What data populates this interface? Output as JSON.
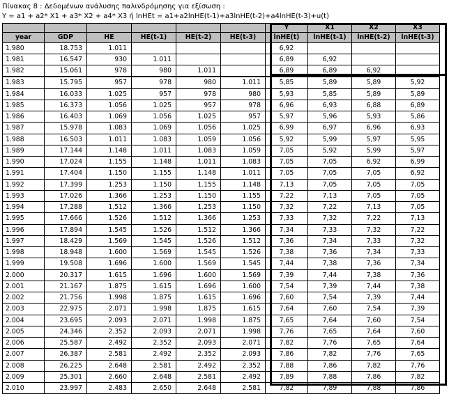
{
  "caption": {
    "line1": "Πίνακας 8 : Δεδομένων ανάλυσης παλινδρόμησης για εξίσωση :",
    "line2": "Y = a1 + a2* X1 + a3* X2 + a4* X3  ή    lnHEt = a1+a2lnHE(t-1)+a3lnHE(t-2)+a4lnHE(t-3)+u(t)"
  },
  "table": {
    "top_headers": [
      "",
      "",
      "",
      "",
      "",
      "",
      "Y",
      "X1",
      "X2",
      "X3"
    ],
    "headers": [
      "year",
      "GDP",
      "HE",
      "HE(t-1)",
      "HE(t-2)",
      "HE(t-3)",
      "lnHE(t)",
      "lnHE(t-1)",
      "lnHE(t-2)",
      "lnHE(t-3)"
    ],
    "rows": [
      [
        "1.980",
        "18.753",
        "1.011",
        "",
        "",
        "",
        "6,92",
        "",
        "",
        ""
      ],
      [
        "1.981",
        "16.547",
        "930",
        "1.011",
        "",
        "",
        "6,89",
        "6,92",
        "",
        ""
      ],
      [
        "1.982",
        "15.061",
        "978",
        "980",
        "1.011",
        "",
        "6,89",
        "6,89",
        "6,92",
        ""
      ],
      [
        "1.983",
        "15.795",
        "957",
        "978",
        "980",
        "1.011",
        "5,85",
        "5,89",
        "5,89",
        "5,92"
      ],
      [
        "1.984",
        "16.033",
        "1.025",
        "957",
        "978",
        "980",
        "5,93",
        "5,85",
        "5,89",
        "5,89"
      ],
      [
        "1.985",
        "16.373",
        "1.056",
        "1.025",
        "957",
        "978",
        "6,96",
        "6,93",
        "6,88",
        "6,89"
      ],
      [
        "1.986",
        "16.403",
        "1.069",
        "1.056",
        "1.025",
        "957",
        "5,97",
        "5,96",
        "5,93",
        "5,86"
      ],
      [
        "1.987",
        "15.978",
        "1.083",
        "1.069",
        "1.056",
        "1.025",
        "6,99",
        "6,97",
        "6,96",
        "6,93"
      ],
      [
        "1.988",
        "16.503",
        "1.011",
        "1.083",
        "1.059",
        "1.056",
        "5,92",
        "5,99",
        "5,97",
        "5,95"
      ],
      [
        "1.989",
        "17.144",
        "1.148",
        "1.011",
        "1.083",
        "1.059",
        "7,05",
        "5,92",
        "5,99",
        "5,97"
      ],
      [
        "1.990",
        "17.024",
        "1.155",
        "1.148",
        "1.011",
        "1.083",
        "7,05",
        "7,05",
        "6,92",
        "6,99"
      ],
      [
        "1.991",
        "17.404",
        "1.150",
        "1.155",
        "1.148",
        "1.011",
        "7,05",
        "7,05",
        "7,05",
        "6,92"
      ],
      [
        "1.992",
        "17.399",
        "1.253",
        "1.150",
        "1.155",
        "1.148",
        "7,13",
        "7,05",
        "7,05",
        "7,05"
      ],
      [
        "1.993",
        "17.026",
        "1.366",
        "1.253",
        "1.150",
        "1.155",
        "7,22",
        "7,13",
        "7,05",
        "7,05"
      ],
      [
        "1.994",
        "17.288",
        "1.512",
        "1.366",
        "1.253",
        "1.150",
        "7,32",
        "7,22",
        "7,13",
        "7,05"
      ],
      [
        "1.995",
        "17.666",
        "1.526",
        "1.512",
        "1.366",
        "1.253",
        "7,33",
        "7,32",
        "7,22",
        "7,13"
      ],
      [
        "1.996",
        "17.894",
        "1.545",
        "1.526",
        "1.512",
        "1.366",
        "7,34",
        "7,33",
        "7,32",
        "7,22"
      ],
      [
        "1.997",
        "18.429",
        "1.569",
        "1.545",
        "1.526",
        "1.512",
        "7,36",
        "7,34",
        "7,33",
        "7,32"
      ],
      [
        "1.998",
        "18.948",
        "1.600",
        "1.569",
        "1.545",
        "1.526",
        "7,38",
        "7,36",
        "7,34",
        "7,33"
      ],
      [
        "1.999",
        "19.508",
        "1.696",
        "1.600",
        "1.569",
        "1.545",
        "7,44",
        "7,38",
        "7,36",
        "7,34"
      ],
      [
        "2.000",
        "20.317",
        "1.615",
        "1.696",
        "1.600",
        "1.569",
        "7,39",
        "7,44",
        "7,38",
        "7,36"
      ],
      [
        "2.001",
        "21.167",
        "1.875",
        "1.615",
        "1.696",
        "1.600",
        "7,54",
        "7,39",
        "7,44",
        "7,38"
      ],
      [
        "2.002",
        "21.756",
        "1.998",
        "1.875",
        "1.615",
        "1.696",
        "7,60",
        "7,54",
        "7,39",
        "7,44"
      ],
      [
        "2.003",
        "22.975",
        "2.071",
        "1.998",
        "1.875",
        "1.615",
        "7,64",
        "7,60",
        "7,54",
        "7,39"
      ],
      [
        "2.004",
        "23.695",
        "2.093",
        "2.071",
        "1.998",
        "1.875",
        "7,65",
        "7,64",
        "7,60",
        "7,54"
      ],
      [
        "2.005",
        "24.346",
        "2.352",
        "2.093",
        "2.071",
        "1.998",
        "7,76",
        "7,65",
        "7,64",
        "7,60"
      ],
      [
        "2.006",
        "25.587",
        "2.492",
        "2.352",
        "2.093",
        "2.071",
        "7,82",
        "7,76",
        "7,65",
        "7,64"
      ],
      [
        "2.007",
        "26.387",
        "2.581",
        "2.492",
        "2.352",
        "2.093",
        "7,86",
        "7,82",
        "7,76",
        "7,65"
      ],
      [
        "2.008",
        "26.225",
        "2.648",
        "2.581",
        "2.492",
        "2.352",
        "7,88",
        "7,86",
        "7,82",
        "7,76"
      ],
      [
        "2.009",
        "25.301",
        "2.660",
        "2.648",
        "2.581",
        "2.492",
        "7,89",
        "7,88",
        "7,86",
        "7,82"
      ],
      [
        "2.010",
        "23.997",
        "2.483",
        "2.650",
        "2.648",
        "2.581",
        "7,82",
        "7,89",
        "7,88",
        "7,86"
      ]
    ]
  }
}
